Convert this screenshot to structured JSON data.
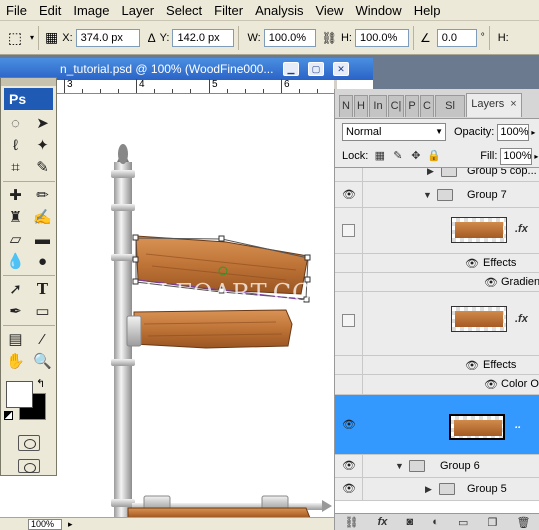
{
  "menu": {
    "items": [
      "File",
      "Edit",
      "Image",
      "Layer",
      "Select",
      "Filter",
      "Analysis",
      "View",
      "Window",
      "Help"
    ]
  },
  "options": {
    "x_label": "X:",
    "x_value": "374.0 px",
    "y_label": "Y:",
    "y_value": "142.0 px",
    "w_label": "W:",
    "w_value": "100.0%",
    "h_label": "H:",
    "h_value": "100.0%",
    "angle_value": "0.0",
    "h2_label": "H:"
  },
  "document": {
    "title": "n_tutorial.psd @ 100% (WoodFine000...",
    "ruler_marks": [
      "3",
      "4",
      "5",
      "6"
    ],
    "zoom": "100%",
    "watermark": "ALFOART.COM"
  },
  "tools": {
    "logo": "Ps"
  },
  "panel": {
    "tabs": [
      "N",
      "H",
      "In",
      "C|",
      "P",
      "C",
      "Sl"
    ],
    "active_tab": "Layers",
    "blend_mode": "Normal",
    "opacity_label": "Opacity:",
    "opacity_value": "100%",
    "lock_label": "Lock:",
    "fill_label": "Fill:",
    "fill_value": "100%",
    "layers": {
      "group5copy": "Group 5 cop...",
      "group7": "Group 7",
      "effects": "Effects",
      "gradient": "Gradien...",
      "color_overlay": "Color O...",
      "group6": "Group 6",
      "group5": "Group 5"
    },
    "selection_color": "#3399ff"
  }
}
